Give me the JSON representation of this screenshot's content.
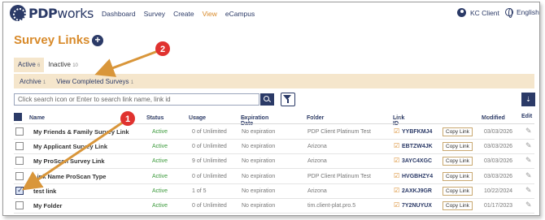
{
  "brand": {
    "name_bold": "PDP",
    "name_light": "works"
  },
  "nav": [
    {
      "label": "Dashboard",
      "active": false
    },
    {
      "label": "Survey",
      "active": false
    },
    {
      "label": "Create",
      "active": false
    },
    {
      "label": "View",
      "active": true
    },
    {
      "label": "eCampus",
      "active": false
    }
  ],
  "user": {
    "name": "KC Client",
    "language": "English"
  },
  "page": {
    "title": "Survey Links",
    "add_button": "+"
  },
  "tabs": [
    {
      "label": "Active",
      "count": "6",
      "active": true
    },
    {
      "label": "Inactive",
      "count": "10",
      "active": false
    }
  ],
  "subbar": [
    {
      "label": "Archive",
      "count": "1"
    },
    {
      "label": "View Completed Surveys",
      "count": "1"
    }
  ],
  "search": {
    "placeholder": "Click search icon or Enter to search link name, link id"
  },
  "table": {
    "headers": {
      "name": "Name",
      "status": "Status",
      "usage": "Usage",
      "expiration": "Expiration Date",
      "folder": "Folder",
      "link_id": "Link ID",
      "modified": "Modified",
      "edit": "Edit"
    },
    "rows": [
      {
        "name": "My Friends & Family Survey Link",
        "status": "Active",
        "usage": "0 of Unlimited",
        "expiration": "No expiration",
        "folder": "PDP Client Platinum Test",
        "link_id": "YYBFKMJ4",
        "copy": "Copy Link",
        "modified": "03/03/2026",
        "checked": false
      },
      {
        "name": "My Applicant Survey Link",
        "status": "Active",
        "usage": "0 of Unlimited",
        "expiration": "No expiration",
        "folder": "Arizona",
        "link_id": "EBTZW4JK",
        "copy": "Copy Link",
        "modified": "03/03/2026",
        "checked": false
      },
      {
        "name": "My ProScan Survey Link",
        "status": "Active",
        "usage": "9 of Unlimited",
        "expiration": "No expiration",
        "folder": "Arizona",
        "link_id": "3AYC4XGC",
        "copy": "Copy Link",
        "modified": "03/03/2026",
        "checked": false
      },
      {
        "name": "Link Name ProScan Type",
        "status": "Active",
        "usage": "0 of Unlimited",
        "expiration": "No expiration",
        "folder": "PDP Client Platinum Test",
        "link_id": "HVGBHZY4",
        "copy": "Copy Link",
        "modified": "03/03/2026",
        "checked": false
      },
      {
        "name": "test link",
        "status": "Active",
        "usage": "1 of 5",
        "expiration": "No expiration",
        "folder": "Arizona",
        "link_id": "2AXKJ9GR",
        "copy": "Copy Link",
        "modified": "10/22/2024",
        "checked": true
      },
      {
        "name": "My Folder",
        "status": "Active",
        "usage": "0 of Unlimited",
        "expiration": "No expiration",
        "folder": "tim.client-plat.pro.5",
        "link_id": "7Y2NUYUX",
        "copy": "Copy Link",
        "modified": "01/17/2023",
        "checked": false
      }
    ]
  },
  "annotations": [
    {
      "number": "1"
    },
    {
      "number": "2"
    }
  ],
  "colors": {
    "navy": "#2b3a67",
    "orange": "#d88a2a",
    "annotation_red": "#e0322f",
    "arrow": "#d9963a",
    "tab_bg": "#f5e6cc",
    "active_green": "#3c9a3c"
  }
}
